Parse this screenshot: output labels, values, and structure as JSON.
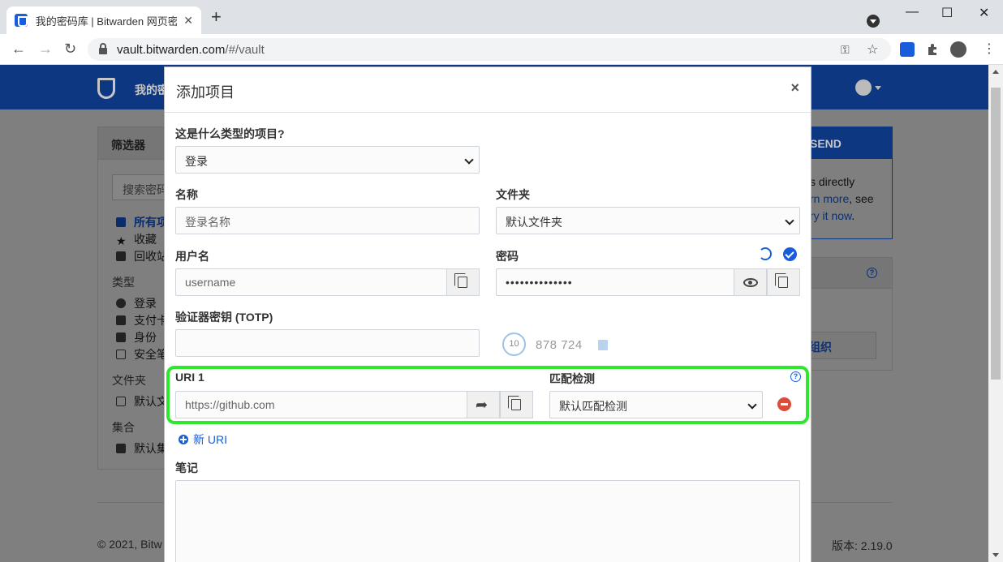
{
  "browser": {
    "tab_title": "我的密码库 | Bitwarden 网页密码",
    "url_host": "vault.bitwarden.com",
    "url_path": "/#/vault",
    "new_tab": "+",
    "minimize": "—",
    "maximize": "☐",
    "close": "✕"
  },
  "page": {
    "nav_title": "我的密",
    "sidebar": {
      "header": "筛选器",
      "search_placeholder": "搜索密码",
      "all_items": "所有项",
      "favorites": "收藏",
      "trash": "回收站",
      "types_label": "类型",
      "type_login": "登录",
      "type_card": "支付卡",
      "type_identity": "身份",
      "type_note": "安全笔",
      "folders_label": "文件夹",
      "folder_default": "默认文",
      "collections_label": "集合",
      "collection_default": "默认集"
    },
    "right_panel": {
      "header": "SEND",
      "line1": "s directly",
      "line2_link": "rn more",
      "line2_rest": ", see",
      "line3_link": "ry it now",
      "line3_rest": ".",
      "org_button": "组织"
    },
    "footer_left": "© 2021, Bitw",
    "footer_right": "版本: 2.19.0"
  },
  "modal": {
    "title": "添加项目",
    "close": "×",
    "type_label": "这是什么类型的项目?",
    "type_value": "登录",
    "name_label": "名称",
    "name_placeholder": "登录名称",
    "folder_label": "文件夹",
    "folder_value": "默认文件夹",
    "username_label": "用户名",
    "username_value": "username",
    "password_label": "密码",
    "password_value": "••••••••••••••",
    "totp_label": "验证器密钥 (TOTP)",
    "totp_value": "",
    "totp_seconds": "10",
    "totp_code": "878  724",
    "uri_label": "URI 1",
    "uri_value": "https://github.com",
    "match_label": "匹配检测",
    "match_value": "默认匹配检测",
    "new_uri": "新 URI",
    "notes_label": "笔记"
  },
  "colors": {
    "accent": "#175ddc",
    "highlight": "#2ee82e",
    "danger": "#dd4b39"
  }
}
